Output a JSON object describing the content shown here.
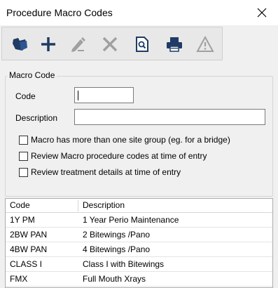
{
  "window": {
    "title": "Procedure Macro Codes",
    "close_icon": "close-icon"
  },
  "toolbar": {
    "buttons": [
      {
        "icon": "open-folder-icon",
        "enabled": true
      },
      {
        "icon": "add-icon",
        "enabled": true
      },
      {
        "icon": "edit-pencil-icon",
        "enabled": false
      },
      {
        "icon": "delete-x-icon",
        "enabled": false
      },
      {
        "icon": "search-document-icon",
        "enabled": true
      },
      {
        "icon": "printer-icon",
        "enabled": true
      },
      {
        "icon": "warning-icon",
        "enabled": false
      }
    ]
  },
  "macro_code": {
    "group_label": "Macro Code",
    "code_label": "Code",
    "code_value": "",
    "description_label": "Description",
    "description_value": "",
    "checkboxes": [
      {
        "label": "Macro has more than one site group (eg. for a bridge)",
        "checked": false
      },
      {
        "label": "Review Macro procedure codes at time of entry",
        "checked": false
      },
      {
        "label": "Review treatment details at time of entry",
        "checked": false
      }
    ]
  },
  "table": {
    "columns": [
      "Code",
      "Description"
    ],
    "rows": [
      {
        "code": "1Y PM",
        "description": "1 Year Perio Maintenance"
      },
      {
        "code": "2BW PAN",
        "description": "2 Bitewings /Pano"
      },
      {
        "code": "4BW PAN",
        "description": "4 Bitewings /Pano"
      },
      {
        "code": "CLASS I",
        "description": "Class I with Bitewings"
      },
      {
        "code": "FMX",
        "description": "Full Mouth Xrays"
      }
    ]
  },
  "colors": {
    "toolbar_icon": "#1f3b66",
    "disabled_icon": "#a0a0a0"
  }
}
